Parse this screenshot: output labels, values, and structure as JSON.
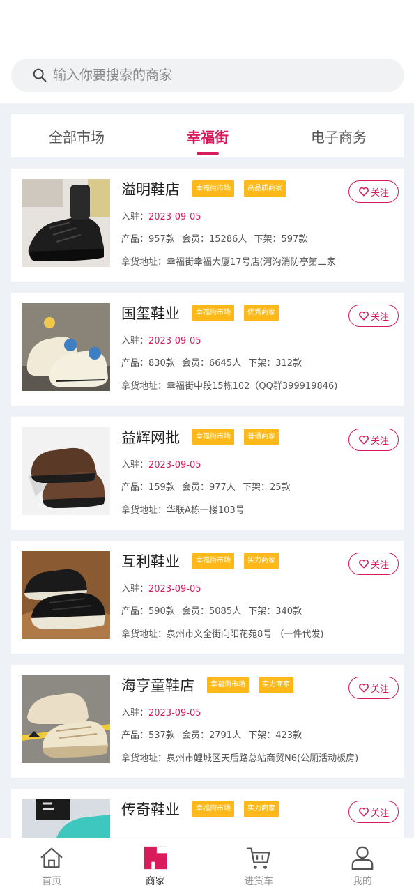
{
  "search": {
    "placeholder": "输入你要搜索的商家"
  },
  "tabs": [
    {
      "label": "全部市场",
      "active": false
    },
    {
      "label": "幸福街",
      "active": true
    },
    {
      "label": "电子商务",
      "active": false
    }
  ],
  "labels": {
    "join": "入驻：",
    "products": "产品：",
    "members": "会员：",
    "delisted": "下架：",
    "address": "拿货地址：",
    "follow": "关注"
  },
  "stores": [
    {
      "name": "溢明鞋店",
      "tags": [
        "幸福街市场",
        "高品质商家"
      ],
      "join_date": "2023-09-05",
      "products": "957款",
      "members": "15286人",
      "delisted": "597款",
      "address": "幸福街幸福大厦17号店(河沟消防亭第二家",
      "image": "black-sneaker"
    },
    {
      "name": "国玺鞋业",
      "tags": [
        "幸福街市场",
        "优秀商家"
      ],
      "join_date": "2023-09-05",
      "products": "830款",
      "members": "6645人",
      "delisted": "312款",
      "address": "幸福街中段15栋102（QQ群399919846)",
      "image": "kids-sneaker"
    },
    {
      "name": "益辉网批",
      "tags": [
        "幸福街市场",
        "普通商家"
      ],
      "join_date": "2023-09-05",
      "products": "159款",
      "members": "977人",
      "delisted": "25款",
      "address": "华联A栋一楼103号",
      "image": "brown-leather-shoe"
    },
    {
      "name": "互利鞋业",
      "tags": [
        "幸福街市场",
        "实力商家"
      ],
      "join_date": "2023-09-05",
      "products": "590款",
      "members": "5085人",
      "delisted": "340款",
      "address": "泉州市义全街向阳花苑8号 （一件代发)",
      "image": "black-skate-shoe"
    },
    {
      "name": "海亨童鞋店",
      "tags": [
        "幸福街市场",
        "实力商家"
      ],
      "join_date": "2023-09-05",
      "products": "537款",
      "members": "2791人",
      "delisted": "423款",
      "address": "泉州市鲤城区天后路总站商贸N6(公厕活动板房)",
      "image": "beige-chunky-sneaker"
    },
    {
      "name": "传奇鞋业",
      "tags": [
        "幸福街市场",
        "实力商家"
      ],
      "image": "teal-sneaker"
    }
  ],
  "nav": [
    {
      "label": "首页",
      "icon": "home-icon",
      "active": false
    },
    {
      "label": "商家",
      "icon": "store-icon",
      "active": true
    },
    {
      "label": "进货车",
      "icon": "cart-icon",
      "active": false
    },
    {
      "label": "我的",
      "icon": "user-icon",
      "active": false
    }
  ],
  "colors": {
    "accent": "#d81b5a",
    "tag_bg": "#ffb81a",
    "page_bg": "#eef1f5"
  }
}
